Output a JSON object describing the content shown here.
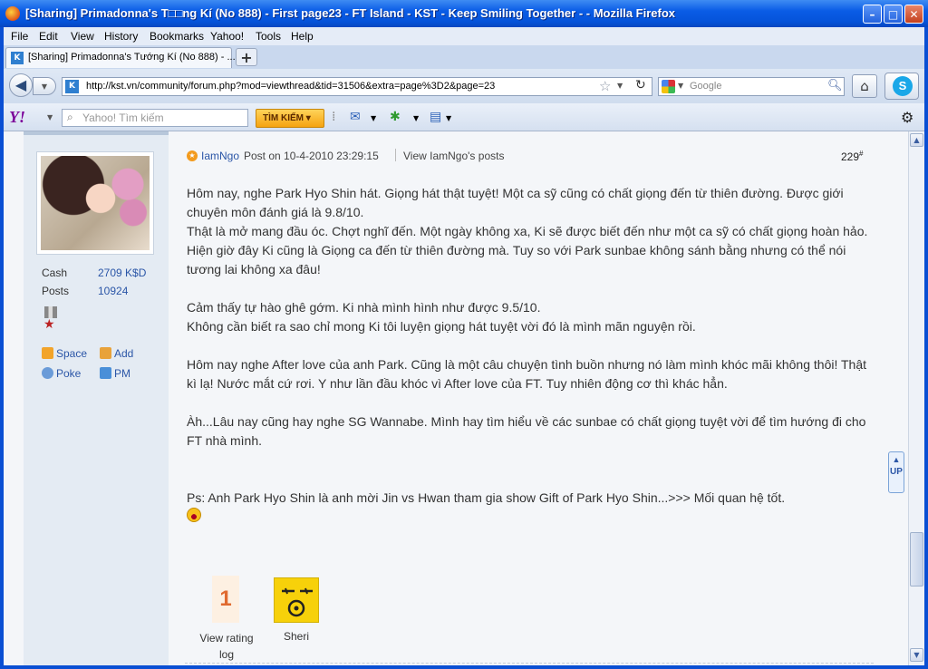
{
  "window": {
    "title": "[Sharing] Primadonna's T□□ng Kí (No 888) - First page23 - FT Island - KST - Keep Smiling Together - - Mozilla Firefox",
    "minimize": "–",
    "maximize": "□",
    "close": "✕"
  },
  "menu": [
    "File",
    "Edit",
    "View",
    "History",
    "Bookmarks",
    "Yahoo!",
    "Tools",
    "Help"
  ],
  "tab": {
    "label": "[Sharing] Primadonna's Tướng Kí (No 888) - ...",
    "new_tab": "+"
  },
  "nav": {
    "url": "http://kst.vn/community/forum.php?mod=viewthread&tid=31506&extra=page%3D2&page=23",
    "search_placeholder": "Google"
  },
  "yahoo": {
    "logo": "Y!",
    "search_placeholder": "Yahoo! Tìm kiếm",
    "search_button": "TÌM KIẾM ▾"
  },
  "profile": {
    "cash_label": "Cash",
    "cash_value": "2709 K$D",
    "posts_label": "Posts",
    "posts_value": "10924",
    "actions": {
      "space": "Space",
      "add": "Add",
      "poke": "Poke",
      "pm": "PM"
    }
  },
  "post": {
    "author": "IamNgo",
    "date": "Post on 10-4-2010 23:29:15",
    "view_posts": "View IamNgo's posts",
    "floor": "229",
    "floor_mark": "#",
    "paragraphs": [
      "Hôm nay, nghe Park Hyo Shin hát. Giọng hát thật tuyệt! Một ca sỹ cũng có chất giọng đến từ thiên đường. Được giới chuyên môn đánh giá là 9.8/10.",
      "Thật là mở mang đầu óc. Chợt nghĩ đến. Một ngày không xa, Ki sẽ được biết đến như một ca sỹ có chất giọng hoàn hảo. Hiện giờ đây Ki cũng là Giọng ca đến từ thiên đường mà. Tuy so với Park sunbae không sánh bằng nhưng có thể nói tương lai không xa đâu!",
      "",
      "Cảm thấy tự hào ghê gớm. Ki nhà mình hình như được 9.5/10.",
      "Không cần biết ra sao chỉ mong Ki tôi luyện giọng hát tuyệt vời đó là mình mãn nguyện rồi.",
      "",
      "Hôm nay nghe After love của anh Park. Cũng là một câu chuyện tình buồn nhưng nó làm mình khóc mãi không thôi! Thật kì lạ! Nước mắt cứ rơi. Y như lần đầu khóc vì After love của FT. Tuy nhiên động cơ thì khác hẳn.",
      "",
      "Àh...Lâu nay cũng hay nghe SG Wannabe. Mình hay tìm hiểu về các sunbae có chất giọng tuyệt vời để tìm hướng đi cho FT nhà mình.",
      "",
      "",
      "Ps: Anh Park Hyo Shin là anh mời Jin vs Hwan tham gia show Gift of Park Hyo Shin...>>> Mối quan hệ tốt."
    ],
    "rating": {
      "count": "1",
      "label": "View rating log"
    },
    "badge": {
      "label": "Sheri"
    }
  },
  "scroll_up": "UP"
}
